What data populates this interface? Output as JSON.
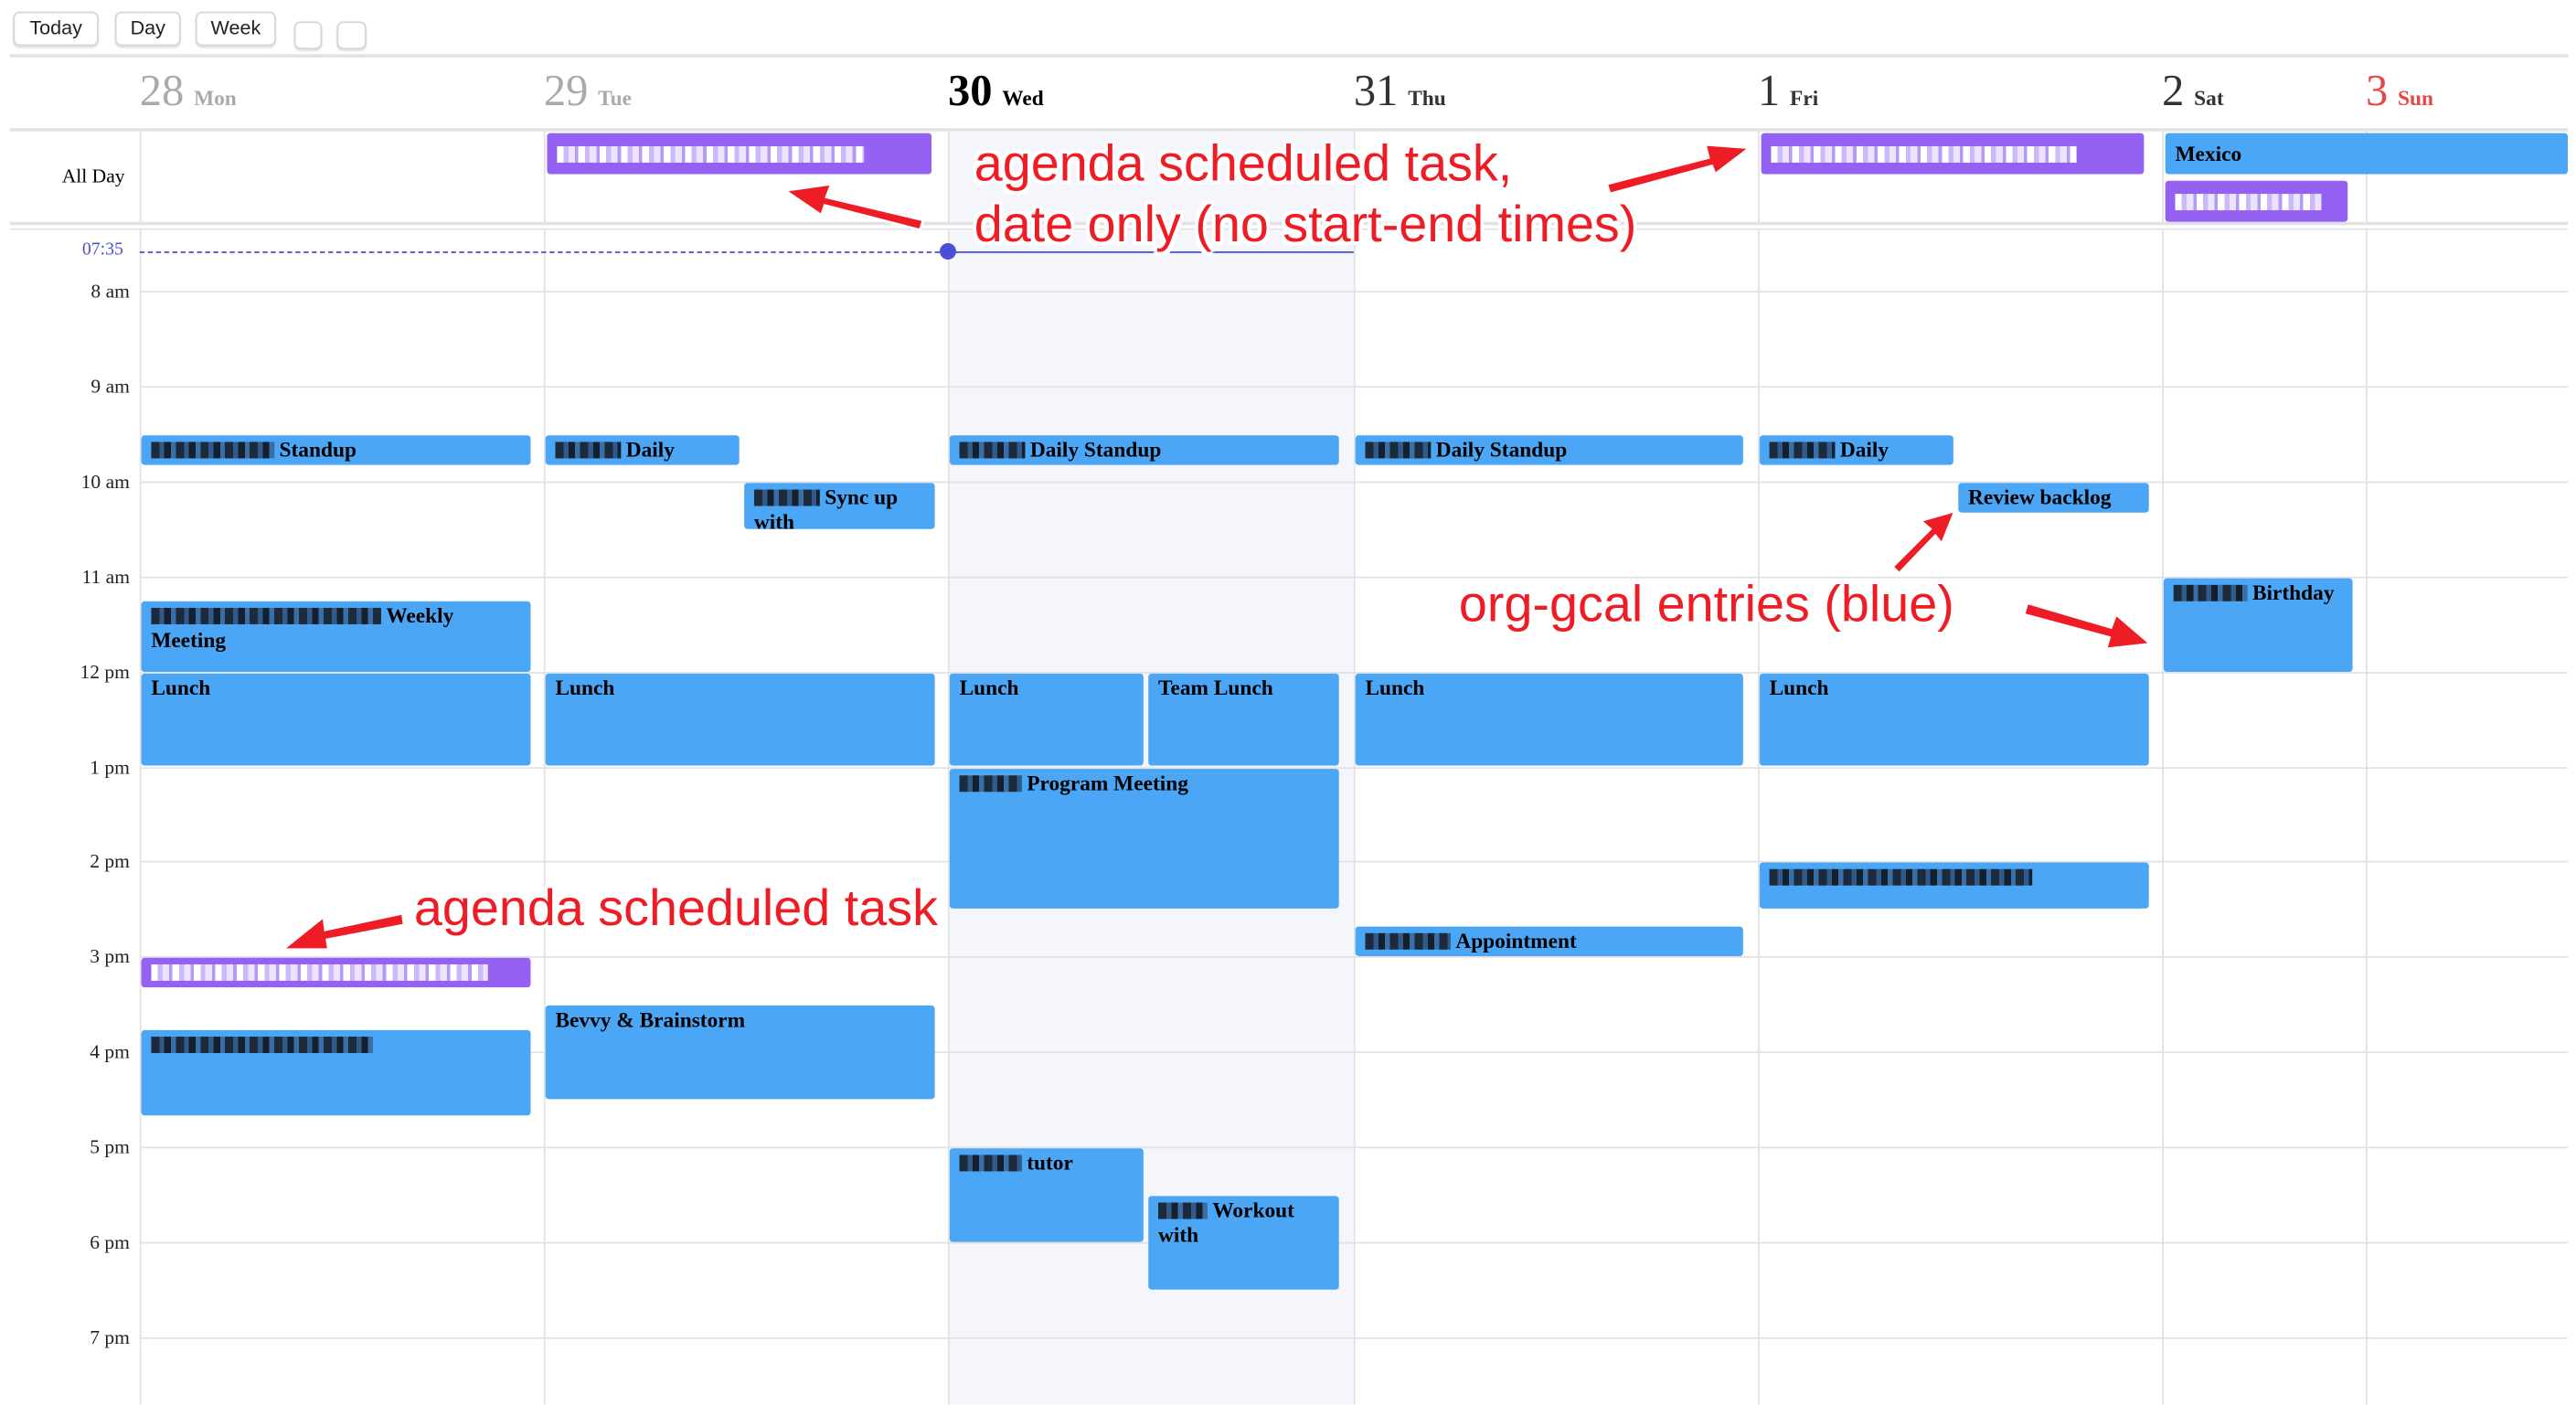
{
  "toolbar": {
    "today_label": "Today",
    "day_label": "Day",
    "week_label": "Week"
  },
  "days": [
    {
      "num": "28",
      "dow": "Mon",
      "state": "past"
    },
    {
      "num": "29",
      "dow": "Tue",
      "state": "past"
    },
    {
      "num": "30",
      "dow": "Wed",
      "state": "today"
    },
    {
      "num": "31",
      "dow": "Thu",
      "state": "future"
    },
    {
      "num": "1",
      "dow": "Fri",
      "state": "future"
    },
    {
      "num": "2",
      "dow": "Sat",
      "state": "future"
    },
    {
      "num": "3",
      "dow": "Sun",
      "state": "sunday"
    }
  ],
  "allday_label": "All Day",
  "now_label": "07:35",
  "now_time": 7.583,
  "hours": [
    "8 am",
    "9 am",
    "10 am",
    "11 am",
    "12 pm",
    "1 pm",
    "2 pm",
    "3 pm",
    "4 pm",
    "5 pm",
    "6 pm",
    "7 pm"
  ],
  "colors": {
    "gcal": "#4ba6f5",
    "task": "#9461f2",
    "today_bg": "#f5f6fb",
    "now_line": "#4a4fd8",
    "sunday": "#e54848",
    "annotation": "#ee1c25"
  },
  "allday_events": [
    {
      "title": "",
      "redacted": true,
      "type": "task",
      "day": "Tue"
    },
    {
      "title": "",
      "redacted": true,
      "type": "task",
      "day": "Fri"
    },
    {
      "title": "Mexico",
      "redacted": false,
      "type": "gcal",
      "day": "Sat–Sun"
    },
    {
      "title": "",
      "redacted": true,
      "type": "task",
      "day": "Sat"
    }
  ],
  "events": [
    {
      "title": "Standup",
      "redacted": true,
      "type": "gcal",
      "day": "Mon",
      "start": 9.5,
      "end": 9.83
    },
    {
      "title": "Daily",
      "redacted": true,
      "type": "gcal",
      "day": "Tue",
      "start": 9.5,
      "end": 9.83
    },
    {
      "title": "Sync up with",
      "redacted": true,
      "type": "gcal",
      "day": "Tue",
      "start": 10,
      "end": 10.5
    },
    {
      "title": "Daily Standup",
      "redacted": true,
      "type": "gcal",
      "day": "Wed",
      "start": 9.5,
      "end": 9.83
    },
    {
      "title": "Daily Standup",
      "redacted": true,
      "type": "gcal",
      "day": "Thu",
      "start": 9.5,
      "end": 9.83
    },
    {
      "title": "Daily",
      "redacted": true,
      "type": "gcal",
      "day": "Fri",
      "start": 9.5,
      "end": 9.83
    },
    {
      "title": "Review backlog",
      "redacted": false,
      "type": "gcal",
      "day": "Fri",
      "start": 10,
      "end": 10.33
    },
    {
      "title": "Weekly Meeting",
      "redacted": true,
      "type": "gcal",
      "day": "Mon",
      "start": 11.25,
      "end": 12
    },
    {
      "title": "Birthday",
      "redacted": true,
      "type": "gcal",
      "day": "Sat",
      "start": 11,
      "end": 12
    },
    {
      "title": "Lunch",
      "redacted": false,
      "type": "gcal",
      "day": "Mon",
      "start": 12,
      "end": 13
    },
    {
      "title": "Lunch",
      "redacted": false,
      "type": "gcal",
      "day": "Tue",
      "start": 12,
      "end": 13
    },
    {
      "title": "Lunch",
      "redacted": false,
      "type": "gcal",
      "day": "Wed",
      "start": 12,
      "end": 13
    },
    {
      "title": "Team Lunch",
      "redacted": false,
      "type": "gcal",
      "day": "Wed",
      "start": 12,
      "end": 13
    },
    {
      "title": "Lunch",
      "redacted": false,
      "type": "gcal",
      "day": "Thu",
      "start": 12,
      "end": 13
    },
    {
      "title": "Lunch",
      "redacted": false,
      "type": "gcal",
      "day": "Fri",
      "start": 12,
      "end": 13
    },
    {
      "title": "Program Meeting",
      "redacted": true,
      "type": "gcal",
      "day": "Wed",
      "start": 13,
      "end": 14.5
    },
    {
      "title": "",
      "redacted": true,
      "type": "gcal",
      "day": "Fri",
      "start": 14,
      "end": 14.5
    },
    {
      "title": "Appointment",
      "redacted": true,
      "type": "gcal",
      "day": "Thu",
      "start": 14.67,
      "end": 15
    },
    {
      "title": "",
      "redacted": true,
      "type": "task",
      "day": "Mon",
      "start": 15,
      "end": 15.33
    },
    {
      "title": "Bevvy & Brainstorm",
      "redacted": false,
      "type": "gcal",
      "day": "Tue",
      "start": 15.5,
      "end": 16.5
    },
    {
      "title": "",
      "redacted": true,
      "type": "gcal",
      "day": "Mon",
      "start": 15.75,
      "end": 16.67
    },
    {
      "title": "tutor",
      "redacted": true,
      "type": "gcal",
      "day": "Wed",
      "start": 17,
      "end": 18
    },
    {
      "title": "Workout with",
      "redacted": true,
      "type": "gcal",
      "day": "Wed",
      "start": 17.5,
      "end": 18.5
    }
  ],
  "annotations": {
    "allday_line1": "agenda scheduled task,",
    "allday_line2": "date only (no start-end times)",
    "gcal": "org-gcal entries (blue)",
    "task": "agenda scheduled task"
  }
}
